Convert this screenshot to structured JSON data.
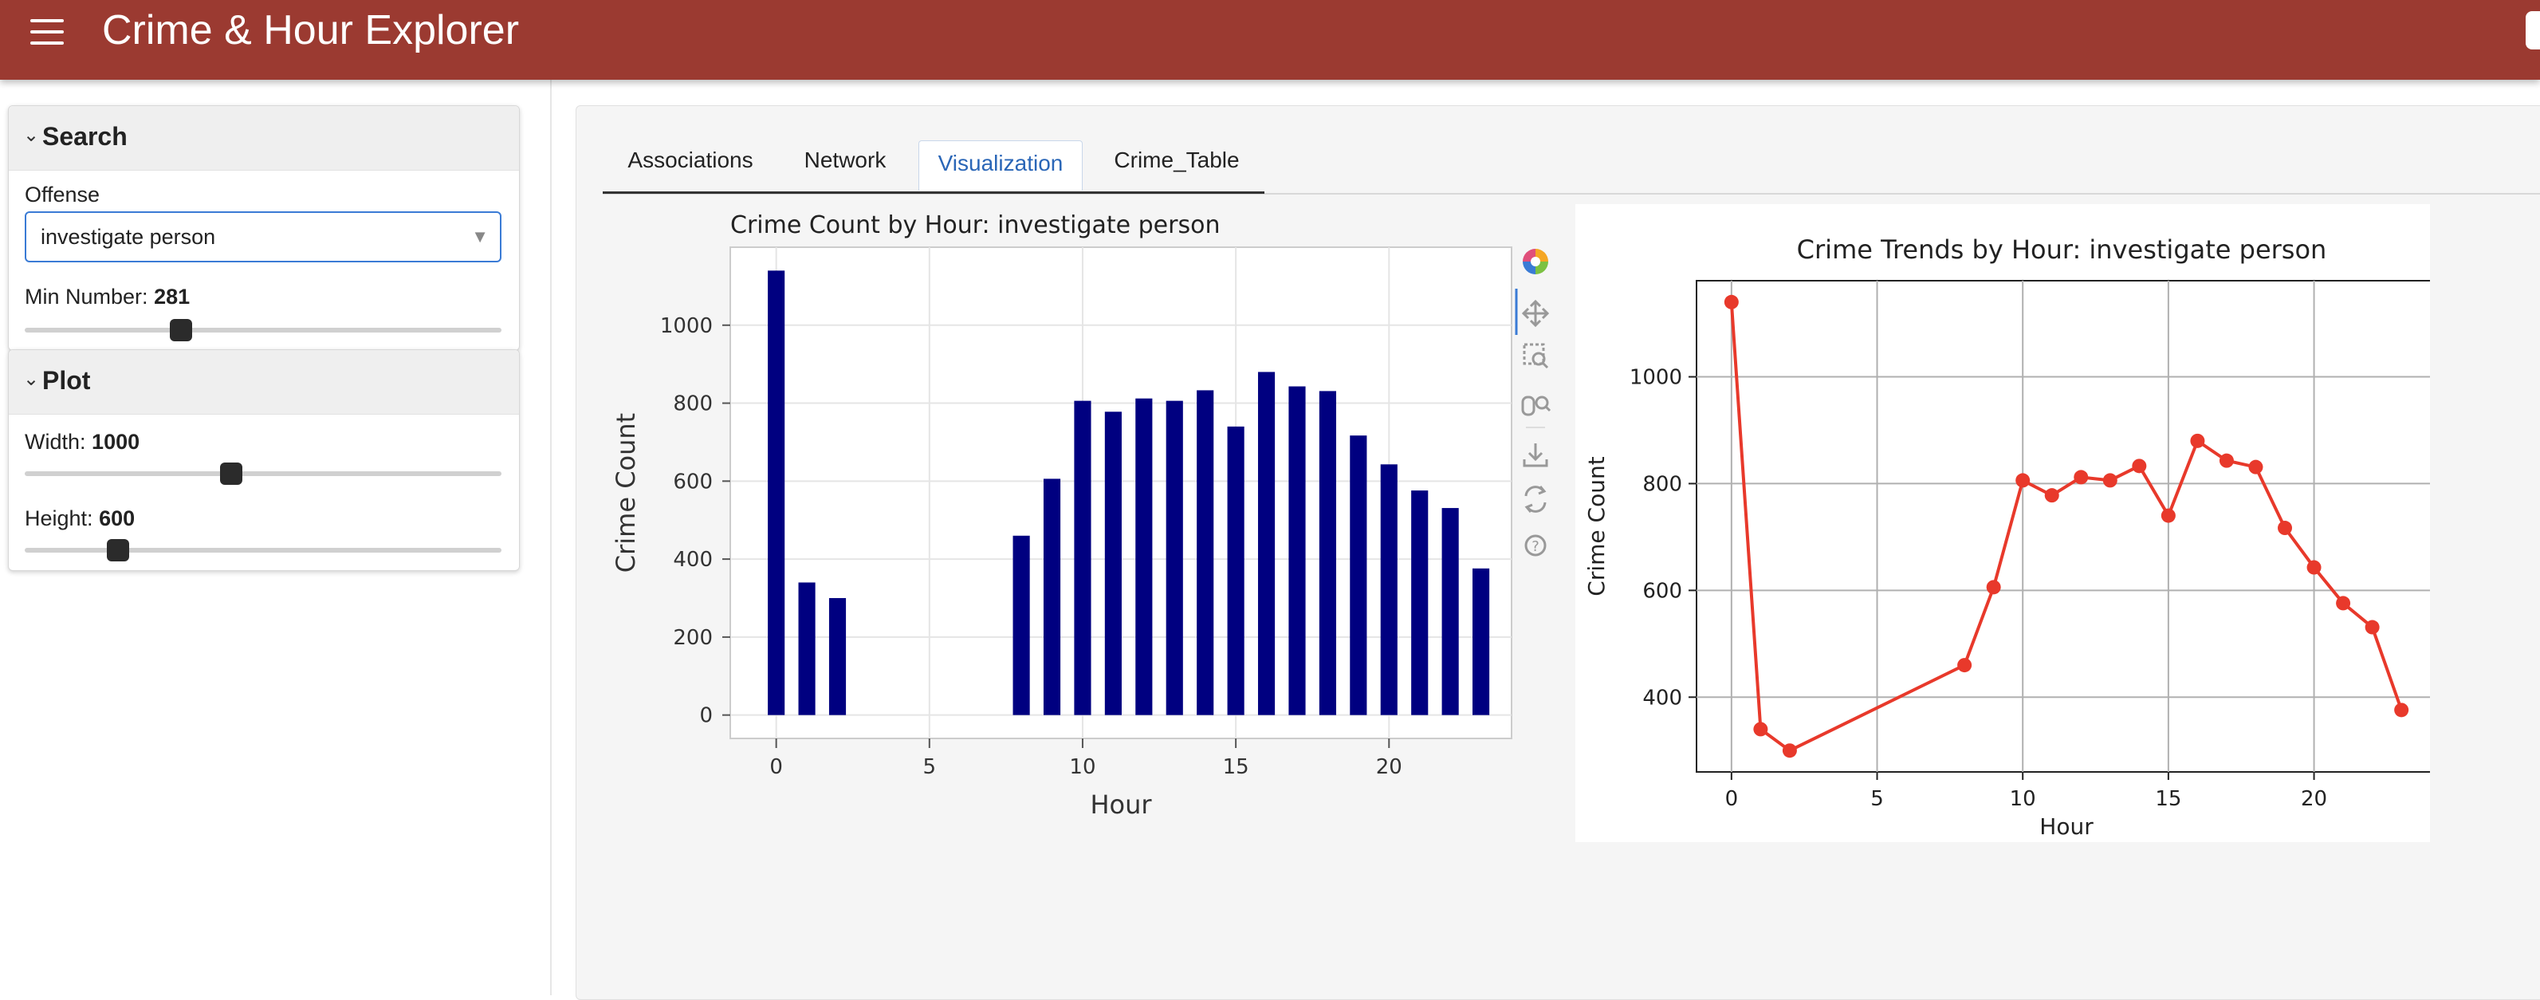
{
  "header": {
    "title": "Crime & Hour Explorer",
    "menu_icon": "hamburger-menu-icon"
  },
  "sidebar": {
    "search": {
      "title": "Search",
      "offense_label": "Offense",
      "offense_value": "investigate person",
      "min_number_label": "Min Number:",
      "min_number_value": "281",
      "min_number_fraction": 0.32
    },
    "plot": {
      "title": "Plot",
      "width_label": "Width:",
      "width_value": "1000",
      "width_fraction": 0.43,
      "height_label": "Height:",
      "height_value": "600",
      "height_fraction": 0.18
    }
  },
  "tabs": [
    {
      "label": "Associations",
      "active": false
    },
    {
      "label": "Network",
      "active": false
    },
    {
      "label": "Visualization",
      "active": true
    },
    {
      "label": "Crime_Table",
      "active": false
    }
  ],
  "toolbar": [
    "bokeh-logo-icon",
    "pan-icon",
    "box-zoom-icon",
    "wheel-zoom-icon",
    "save-icon",
    "reset-icon",
    "help-icon"
  ],
  "chart_data": [
    {
      "type": "bar",
      "title": "Crime Count by Hour: investigate person",
      "xlabel": "Hour",
      "ylabel": "Crime Count",
      "x": [
        0,
        1,
        2,
        8,
        9,
        10,
        11,
        12,
        13,
        14,
        15,
        16,
        17,
        18,
        19,
        20,
        21,
        22,
        23
      ],
      "values": [
        1140,
        340,
        300,
        460,
        606,
        806,
        778,
        812,
        806,
        833,
        740,
        880,
        843,
        831,
        717,
        643,
        576,
        531,
        376
      ],
      "xticks": [
        0,
        5,
        10,
        15,
        20
      ],
      "yticks": [
        0,
        200,
        400,
        600,
        800,
        1000
      ],
      "xlim": [
        -1.5,
        24
      ],
      "ylim": [
        -60,
        1200
      ],
      "color": "#000080",
      "grid": true
    },
    {
      "type": "line",
      "title": "Crime Trends by Hour: investigate person",
      "xlabel": "Hour",
      "ylabel": "Crime Count",
      "x": [
        0,
        1,
        2,
        8,
        9,
        10,
        11,
        12,
        13,
        14,
        15,
        16,
        17,
        18,
        19,
        20,
        21,
        22,
        23
      ],
      "values": [
        1140,
        340,
        300,
        460,
        606,
        806,
        778,
        812,
        806,
        833,
        740,
        880,
        843,
        831,
        717,
        643,
        576,
        531,
        376
      ],
      "xticks": [
        0,
        5,
        10,
        15,
        20
      ],
      "yticks": [
        400,
        600,
        800,
        1000
      ],
      "xlim": [
        -1.2,
        24.2
      ],
      "ylim": [
        260,
        1180
      ],
      "color": "#e8392b",
      "grid": true
    }
  ]
}
